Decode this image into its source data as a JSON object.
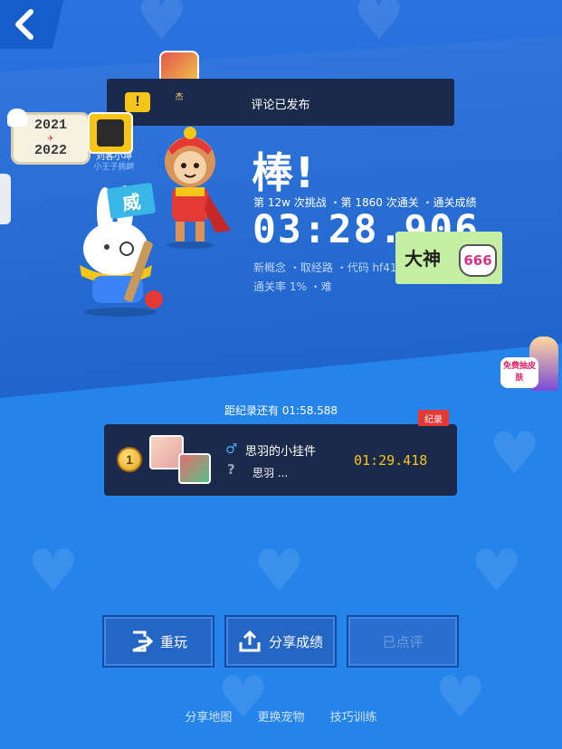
{
  "toast": {
    "text": "评论已发布"
  },
  "stickers": {
    "year_top": "2021",
    "year_bottom": "2022",
    "friend_name": "刘客小坤",
    "friend_sub": "小王子挑衅",
    "avatar_mini_label": "杰",
    "rabbit_sign": "威",
    "dashen_text": "大神",
    "dashen_badge": "666",
    "free_skin": "免费抽皮肤"
  },
  "result": {
    "title": "棒!",
    "challenge_line": "第 12w 次挑战 ・第 1860 次通关 ・通关成绩",
    "time": "03:28.906",
    "level_line": "新概念 ・取经路 ・代码 hf419",
    "rate_line": "通关率 1% ・难"
  },
  "record": {
    "gap_text": "距纪录还有 01:58.588",
    "tag": "纪录",
    "rank": "1",
    "player_name": "思羽的小挂件",
    "player_sub": "思羽 ...",
    "time": "01:29.418"
  },
  "buttons": {
    "replay": "重玩",
    "share": "分享成绩",
    "rated": "已点评"
  },
  "footer": {
    "share_map": "分享地图",
    "change_pet": "更换宠物",
    "skill_training": "技巧训练"
  }
}
